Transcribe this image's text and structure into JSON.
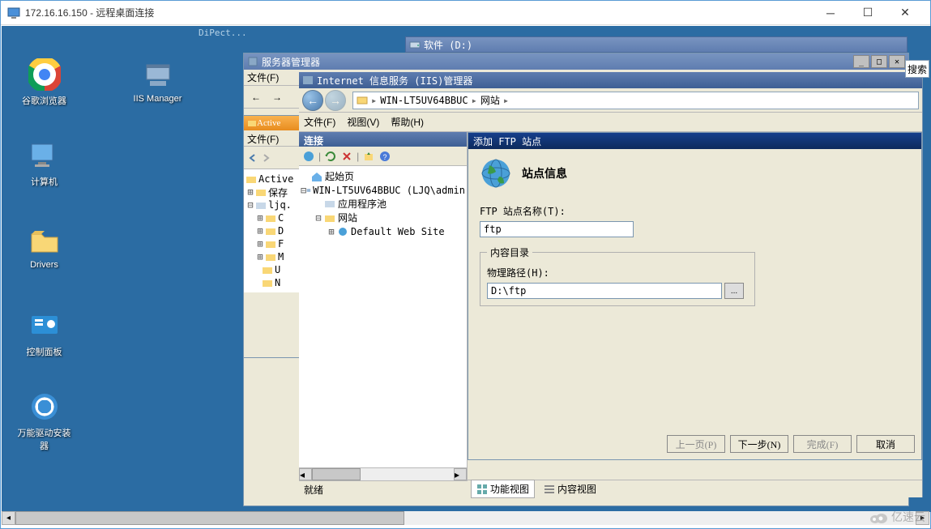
{
  "rdp": {
    "title": "172.16.16.150 - 远程桌面连接"
  },
  "desktop": {
    "direct_text": "DiPect...",
    "icons": {
      "chrome": "谷歌浏览器",
      "iis": "IIS Manager",
      "computer": "计算机",
      "drivers": "Drivers",
      "control": "控制面板",
      "driverinst": "万能驱动安装器"
    }
  },
  "soft_win": {
    "title": "软件 (D:)"
  },
  "server_manager": {
    "title": "服务器管理器",
    "menu": {
      "file": "文件(F)"
    },
    "back_arrow": "←",
    "forward_arrow": "→"
  },
  "ad_panel": {
    "title": "Active",
    "menu_file": "文件(F)",
    "tree": {
      "root": "Active",
      "saved": "保存",
      "domain": "ljq.",
      "c": "C",
      "d": "D",
      "f": "F",
      "m": "M",
      "u": "U",
      "n": "N"
    }
  },
  "iis": {
    "title": "Internet 信息服务 (IIS)管理器",
    "path": {
      "host": "WIN-LT5UV64BBUC",
      "site": "网站"
    },
    "menu": {
      "file": "文件(F)",
      "view": "视图(V)",
      "help": "帮助(H)"
    },
    "conn": {
      "header": "连接",
      "tree": {
        "start": "起始页",
        "host": "WIN-LT5UV64BBUC (LJQ\\admin",
        "apppool": "应用程序池",
        "sites": "网站",
        "default": "Default Web Site"
      }
    },
    "views": {
      "func": "功能视图",
      "content": "内容视图"
    },
    "status": "就绪",
    "search_placeholder": "搜索"
  },
  "ftp_dialog": {
    "title": "添加 FTP 站点",
    "header": "站点信息",
    "site_name_label": "FTP 站点名称(T):",
    "site_name_value": "ftp",
    "content_group": "内容目录",
    "path_label": "物理路径(H):",
    "path_value": "D:\\ftp",
    "browse": "...",
    "btn_prev": "上一页(P)",
    "btn_next": "下一步(N)",
    "btn_finish": "完成(F)",
    "btn_cancel": "取消"
  },
  "watermark": "亿速云"
}
